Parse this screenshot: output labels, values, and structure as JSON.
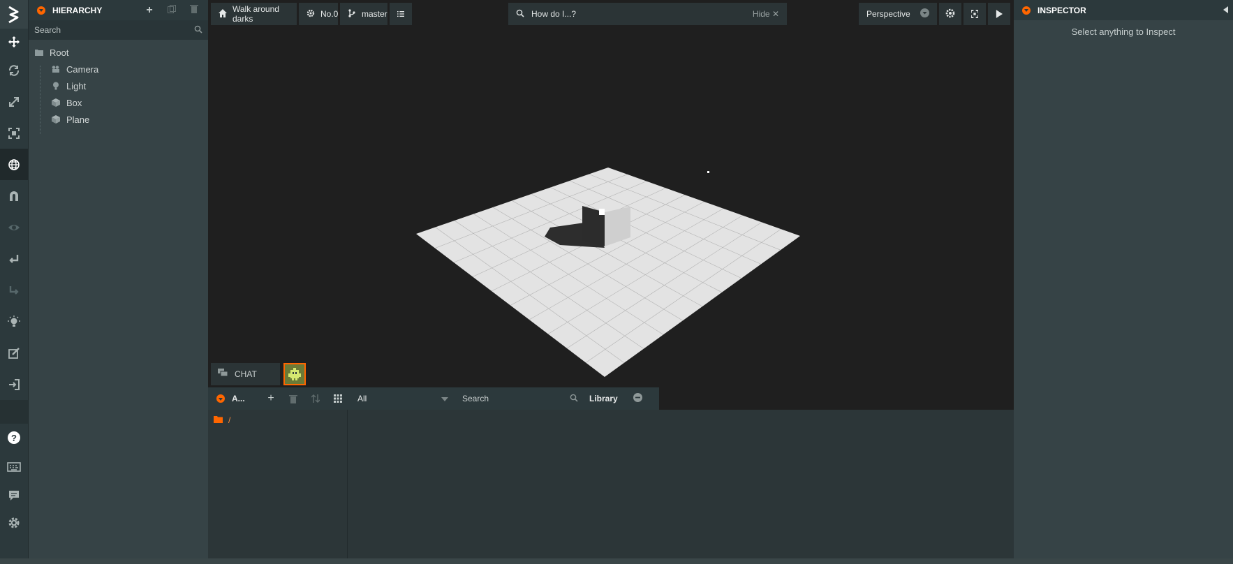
{
  "toolbar": {
    "tools": [
      "logo-icon",
      "move-icon",
      "rotate-icon",
      "scale-icon",
      "resize-icon",
      "world-icon",
      "snap-icon",
      "eye-icon",
      "undo-icon",
      "redo-icon",
      "light-icon",
      "edit-icon",
      "publish-icon",
      "help-icon",
      "keyboard-icon",
      "chat-icon",
      "settings-icon"
    ]
  },
  "hierarchy": {
    "title": "HIERARCHY",
    "search_placeholder": "Search",
    "root": "Root",
    "items": [
      "Camera",
      "Light",
      "Box",
      "Plane"
    ]
  },
  "viewport": {
    "project_label": "Walk around darks",
    "settings_label": "No.0",
    "branch_label": "master",
    "search_text": "How do I...?",
    "hide_label": "Hide",
    "camera_label": "Perspective",
    "chat_label": "CHAT",
    "colors": {
      "plane": "#e3e3e3",
      "background": "#1f1f1f"
    }
  },
  "assets": {
    "title": "A...",
    "filter": "All",
    "search_placeholder": "Search",
    "library_label": "Library",
    "root_folder": "/"
  },
  "inspector": {
    "title": "INSPECTOR",
    "empty_message": "Select anything to Inspect"
  },
  "colors": {
    "accent": "#ff6600",
    "panel": "#364346",
    "header": "#2c393c"
  }
}
